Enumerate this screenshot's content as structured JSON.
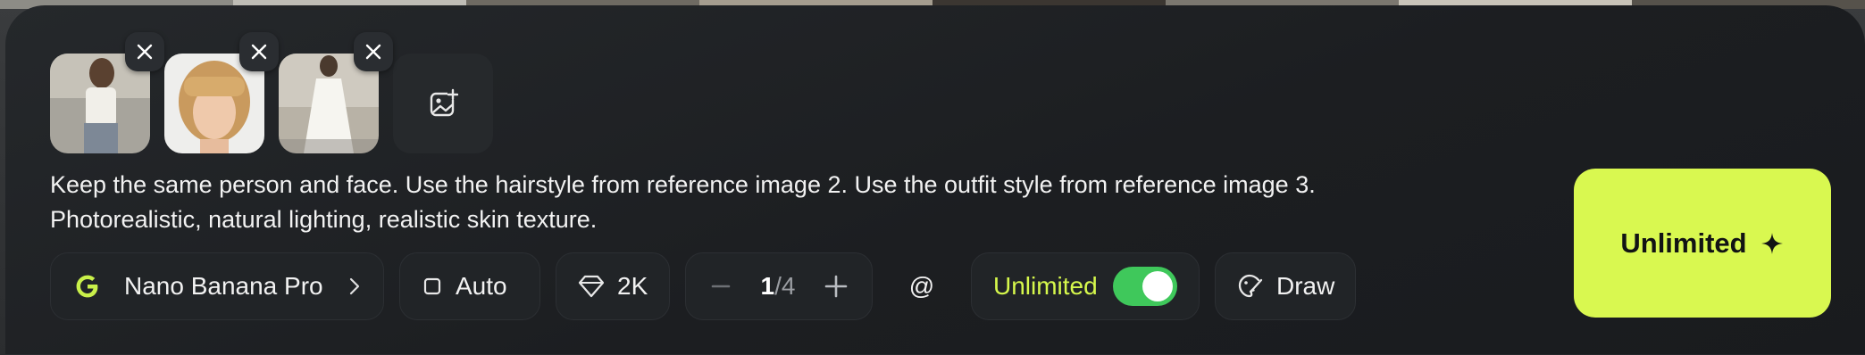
{
  "reference_images": [
    {
      "alt": "reference image 1"
    },
    {
      "alt": "reference image 2"
    },
    {
      "alt": "reference image 3"
    }
  ],
  "prompt": {
    "line1": "Keep the same person and face. Use the hairstyle from reference image 2. Use the outfit style from reference image 3.",
    "line2": "Photorealistic, natural lighting, realistic skin texture."
  },
  "toolbar": {
    "model_label": "Nano Banana Pro",
    "aspect_label": "Auto",
    "resolution_label": "2K",
    "count_current": "1",
    "count_total": "/4",
    "mention_label": "@",
    "unlimited_label": "Unlimited",
    "unlimited_enabled": true,
    "draw_label": "Draw"
  },
  "generate_button": {
    "label": "Unlimited"
  },
  "colors": {
    "accent": "#d9f850",
    "toggle_on": "#3fc85b",
    "panel": "#1c1e21"
  }
}
